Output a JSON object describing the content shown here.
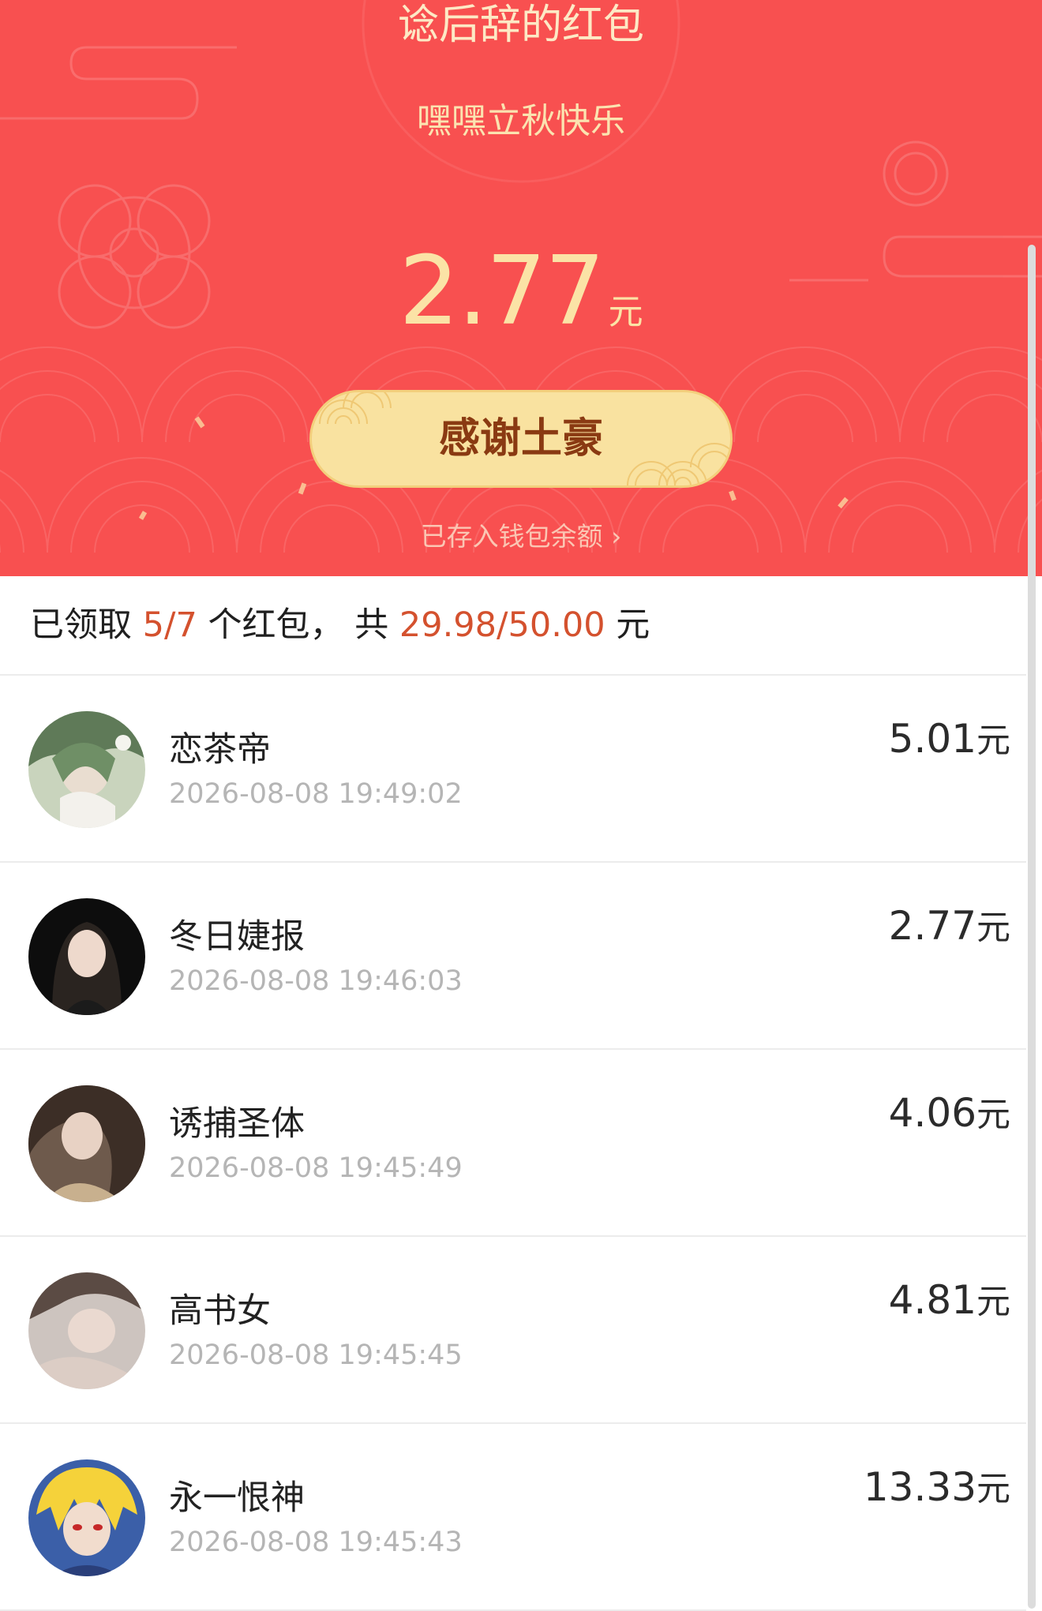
{
  "header": {
    "sender_title": "谂后辞的红包",
    "greeting": "嘿嘿立秋快乐",
    "amount": "2.77",
    "amount_unit": "元",
    "thank_button_label": "感谢土豪",
    "wallet_link": "已存入钱包余额 ›"
  },
  "summary": {
    "prefix": "已领取 ",
    "claimed_count": "5/7",
    "middle": " 个红包， 共 ",
    "claimed_amount": "29.98/50.00",
    "suffix": " 元"
  },
  "records": [
    {
      "name": "恋茶帝",
      "time": "2026-08-08 19:49:02",
      "amount": "5.01",
      "unit": "元"
    },
    {
      "name": "冬日婕报",
      "time": "2026-08-08 19:46:03",
      "amount": "2.77",
      "unit": "元"
    },
    {
      "name": "诱捕圣体",
      "time": "2026-08-08 19:45:49",
      "amount": "4.06",
      "unit": "元"
    },
    {
      "name": "高书女",
      "time": "2026-08-08 19:45:45",
      "amount": "4.81",
      "unit": "元"
    },
    {
      "name": "永一恨神",
      "time": "2026-08-08 19:45:43",
      "amount": "13.33",
      "unit": "元"
    }
  ],
  "colors": {
    "header_red": "#f85050",
    "gold_text": "#fbe3a6",
    "button_gold": "#f9e2a0",
    "button_text": "#8a3a12",
    "highlight": "#d4512e"
  }
}
